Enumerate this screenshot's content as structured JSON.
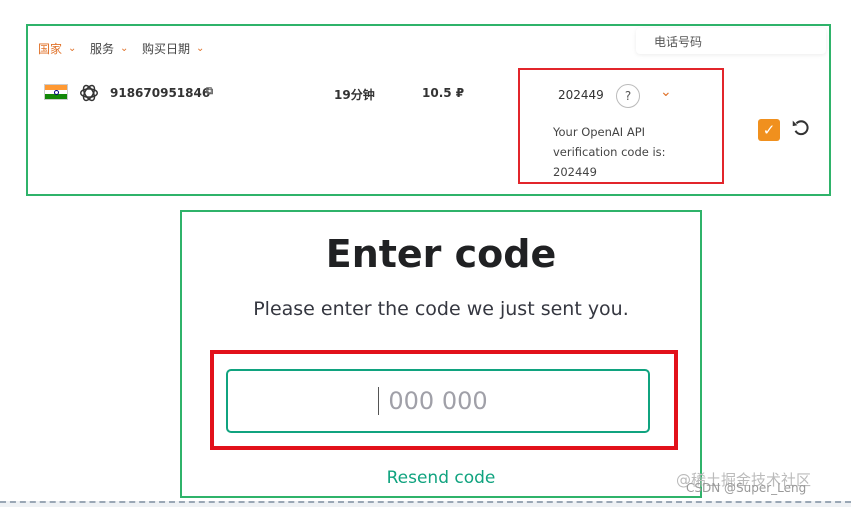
{
  "filters": [
    {
      "label": "国家",
      "active": true
    },
    {
      "label": "服务",
      "active": false
    },
    {
      "label": "购买日期",
      "active": false
    }
  ],
  "search": {
    "placeholder": "电话号码"
  },
  "row": {
    "flag": "india-flag-icon",
    "service_icon": "openai-icon",
    "phone_number": "918670951846",
    "duration": "19分钟",
    "price": "10.5 ₽",
    "code": "202449",
    "help": "?",
    "sms_text": "Your OpenAI API verification code is: 202449"
  },
  "verify": {
    "title": "Enter code",
    "subtitle": "Please enter the code we just sent you.",
    "input_placeholder": "000 000",
    "resend_label": "Resend code"
  },
  "watermark": {
    "line1": "@稀土掘金技术社区",
    "line2": "CSDN @Super_Leng"
  },
  "colors": {
    "accent_orange": "#e0722a",
    "highlight_red": "#e2252b",
    "frame_green": "#2fb36a",
    "openai_green": "#10a37f"
  }
}
